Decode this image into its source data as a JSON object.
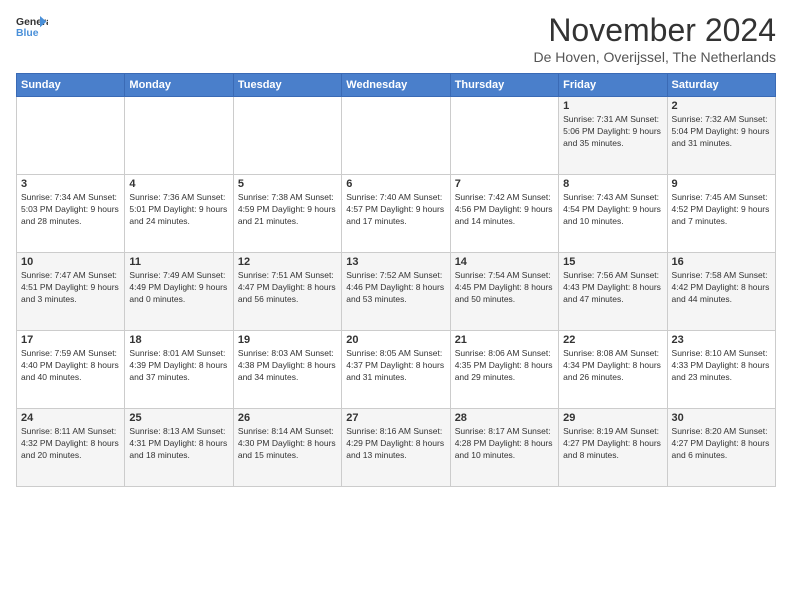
{
  "header": {
    "logo_line1": "General",
    "logo_line2": "Blue",
    "title": "November 2024",
    "location": "De Hoven, Overijssel, The Netherlands"
  },
  "weekdays": [
    "Sunday",
    "Monday",
    "Tuesday",
    "Wednesday",
    "Thursday",
    "Friday",
    "Saturday"
  ],
  "weeks": [
    [
      {
        "day": "",
        "info": ""
      },
      {
        "day": "",
        "info": ""
      },
      {
        "day": "",
        "info": ""
      },
      {
        "day": "",
        "info": ""
      },
      {
        "day": "",
        "info": ""
      },
      {
        "day": "1",
        "info": "Sunrise: 7:31 AM\nSunset: 5:06 PM\nDaylight: 9 hours and 35 minutes."
      },
      {
        "day": "2",
        "info": "Sunrise: 7:32 AM\nSunset: 5:04 PM\nDaylight: 9 hours and 31 minutes."
      }
    ],
    [
      {
        "day": "3",
        "info": "Sunrise: 7:34 AM\nSunset: 5:03 PM\nDaylight: 9 hours and 28 minutes."
      },
      {
        "day": "4",
        "info": "Sunrise: 7:36 AM\nSunset: 5:01 PM\nDaylight: 9 hours and 24 minutes."
      },
      {
        "day": "5",
        "info": "Sunrise: 7:38 AM\nSunset: 4:59 PM\nDaylight: 9 hours and 21 minutes."
      },
      {
        "day": "6",
        "info": "Sunrise: 7:40 AM\nSunset: 4:57 PM\nDaylight: 9 hours and 17 minutes."
      },
      {
        "day": "7",
        "info": "Sunrise: 7:42 AM\nSunset: 4:56 PM\nDaylight: 9 hours and 14 minutes."
      },
      {
        "day": "8",
        "info": "Sunrise: 7:43 AM\nSunset: 4:54 PM\nDaylight: 9 hours and 10 minutes."
      },
      {
        "day": "9",
        "info": "Sunrise: 7:45 AM\nSunset: 4:52 PM\nDaylight: 9 hours and 7 minutes."
      }
    ],
    [
      {
        "day": "10",
        "info": "Sunrise: 7:47 AM\nSunset: 4:51 PM\nDaylight: 9 hours and 3 minutes."
      },
      {
        "day": "11",
        "info": "Sunrise: 7:49 AM\nSunset: 4:49 PM\nDaylight: 9 hours and 0 minutes."
      },
      {
        "day": "12",
        "info": "Sunrise: 7:51 AM\nSunset: 4:47 PM\nDaylight: 8 hours and 56 minutes."
      },
      {
        "day": "13",
        "info": "Sunrise: 7:52 AM\nSunset: 4:46 PM\nDaylight: 8 hours and 53 minutes."
      },
      {
        "day": "14",
        "info": "Sunrise: 7:54 AM\nSunset: 4:45 PM\nDaylight: 8 hours and 50 minutes."
      },
      {
        "day": "15",
        "info": "Sunrise: 7:56 AM\nSunset: 4:43 PM\nDaylight: 8 hours and 47 minutes."
      },
      {
        "day": "16",
        "info": "Sunrise: 7:58 AM\nSunset: 4:42 PM\nDaylight: 8 hours and 44 minutes."
      }
    ],
    [
      {
        "day": "17",
        "info": "Sunrise: 7:59 AM\nSunset: 4:40 PM\nDaylight: 8 hours and 40 minutes."
      },
      {
        "day": "18",
        "info": "Sunrise: 8:01 AM\nSunset: 4:39 PM\nDaylight: 8 hours and 37 minutes."
      },
      {
        "day": "19",
        "info": "Sunrise: 8:03 AM\nSunset: 4:38 PM\nDaylight: 8 hours and 34 minutes."
      },
      {
        "day": "20",
        "info": "Sunrise: 8:05 AM\nSunset: 4:37 PM\nDaylight: 8 hours and 31 minutes."
      },
      {
        "day": "21",
        "info": "Sunrise: 8:06 AM\nSunset: 4:35 PM\nDaylight: 8 hours and 29 minutes."
      },
      {
        "day": "22",
        "info": "Sunrise: 8:08 AM\nSunset: 4:34 PM\nDaylight: 8 hours and 26 minutes."
      },
      {
        "day": "23",
        "info": "Sunrise: 8:10 AM\nSunset: 4:33 PM\nDaylight: 8 hours and 23 minutes."
      }
    ],
    [
      {
        "day": "24",
        "info": "Sunrise: 8:11 AM\nSunset: 4:32 PM\nDaylight: 8 hours and 20 minutes."
      },
      {
        "day": "25",
        "info": "Sunrise: 8:13 AM\nSunset: 4:31 PM\nDaylight: 8 hours and 18 minutes."
      },
      {
        "day": "26",
        "info": "Sunrise: 8:14 AM\nSunset: 4:30 PM\nDaylight: 8 hours and 15 minutes."
      },
      {
        "day": "27",
        "info": "Sunrise: 8:16 AM\nSunset: 4:29 PM\nDaylight: 8 hours and 13 minutes."
      },
      {
        "day": "28",
        "info": "Sunrise: 8:17 AM\nSunset: 4:28 PM\nDaylight: 8 hours and 10 minutes."
      },
      {
        "day": "29",
        "info": "Sunrise: 8:19 AM\nSunset: 4:27 PM\nDaylight: 8 hours and 8 minutes."
      },
      {
        "day": "30",
        "info": "Sunrise: 8:20 AM\nSunset: 4:27 PM\nDaylight: 8 hours and 6 minutes."
      }
    ]
  ]
}
